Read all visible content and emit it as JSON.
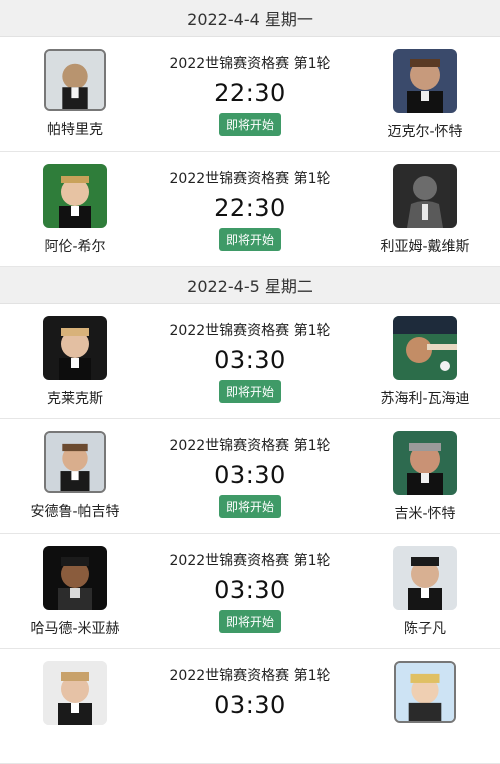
{
  "groups": [
    {
      "date": "2022-4-4 星期一",
      "matches": [
        {
          "left": "帕特里克",
          "right": "迈克尔-怀特",
          "round": "2022世锦赛资格赛 第1轮",
          "time": "22:30",
          "status": "即将开始"
        },
        {
          "left": "阿伦-希尔",
          "right": "利亚姆-戴维斯",
          "round": "2022世锦赛资格赛 第1轮",
          "time": "22:30",
          "status": "即将开始"
        }
      ]
    },
    {
      "date": "2022-4-5 星期二",
      "matches": [
        {
          "left": "克莱克斯",
          "right": "苏海利-瓦海迪",
          "round": "2022世锦赛资格赛 第1轮",
          "time": "03:30",
          "status": "即将开始"
        },
        {
          "left": "安德鲁-帕吉特",
          "right": "吉米-怀特",
          "round": "2022世锦赛资格赛 第1轮",
          "time": "03:30",
          "status": "即将开始"
        },
        {
          "left": "哈马德-米亚赫",
          "right": "陈子凡",
          "round": "2022世锦赛资格赛 第1轮",
          "time": "03:30",
          "status": "即将开始"
        },
        {
          "left": "",
          "right": "",
          "round": "2022世锦赛资格赛 第1轮",
          "time": "03:30",
          "status": ""
        }
      ]
    }
  ],
  "colors": {
    "status_bg": "#3f9a67",
    "header_bg": "#f0f0f0"
  }
}
